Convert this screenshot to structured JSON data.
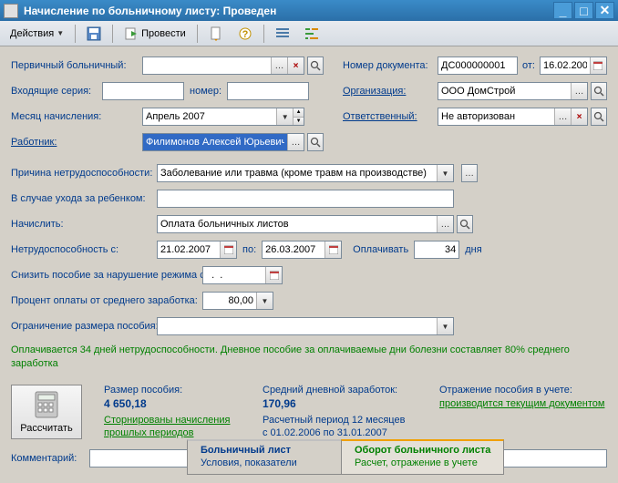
{
  "window": {
    "title": "Начисление по больничному листу: Проведен"
  },
  "toolbar": {
    "actions_label": "Действия",
    "provesti_label": "Провести"
  },
  "left": {
    "primary_label": "Первичный больничный:",
    "primary_value": "",
    "incoming_series_label": "Входящие серия:",
    "incoming_series_value": "",
    "incoming_num_label": "номер:",
    "incoming_num_value": "",
    "month_label": "Месяц начисления:",
    "month_value": "Апрель 2007",
    "worker_label": "Работник:",
    "worker_value": "Филимонов Алексей Юрьевич"
  },
  "right": {
    "docnum_label": "Номер документа:",
    "docnum_value": "ДС000000001",
    "date_label": "от:",
    "date_value": "16.02.2007",
    "org_label": "Организация:",
    "org_value": "ООО ДомСтрой",
    "resp_label": "Ответственный:",
    "resp_value": "Не авторизован"
  },
  "mid": {
    "reason_label": "Причина нетрудоспособности:",
    "reason_value": "Заболевание или травма (кроме травм на производстве)",
    "child_label": "В случае ухода за ребенком:",
    "child_value": "",
    "accrue_label": "Начислить:",
    "accrue_value": "Оплата больничных листов",
    "disability_from_label": "Нетрудоспособность с:",
    "from_value": "21.02.2007",
    "to_label": "по:",
    "to_value": "26.03.2007",
    "pay_label": "Оплачивать",
    "pay_days": "34",
    "pay_unit": "дня",
    "reduce_label": "Снизить пособие за нарушение режима с:",
    "reduce_value": "  .  .",
    "percent_label": "Процент оплаты от среднего заработка:",
    "percent_value": "80,00",
    "limit_label": "Ограничение размера пособия:",
    "limit_value": ""
  },
  "note": "Оплачивается 34 дней нетрудоспособности. Дневное пособие за оплачиваемые дни болезни составляет 80% среднего заработка",
  "summary": {
    "calc_btn": "Рассчитать",
    "size_label": "Размер пособия:",
    "size_value": "4 650,18",
    "storno_link": "Сторнированы начисления прошлых периодов",
    "avg_label": "Средний дневной заработок:",
    "avg_value": "170,96",
    "avg_sub1": "Расчетный период 12 месяцев",
    "avg_sub2": "с 01.02.2006 по 31.01.2007",
    "acct_label": "Отражение пособия в учете:",
    "acct_link": "производится текущим документом"
  },
  "comment": {
    "label": "Комментарий:",
    "value": ""
  },
  "tabs": {
    "t1_title": "Больничный лист",
    "t1_sub": "Условия, показатели",
    "t2_title": "Оборот больничного листа",
    "t2_sub": "Расчет, отражение в учете"
  }
}
